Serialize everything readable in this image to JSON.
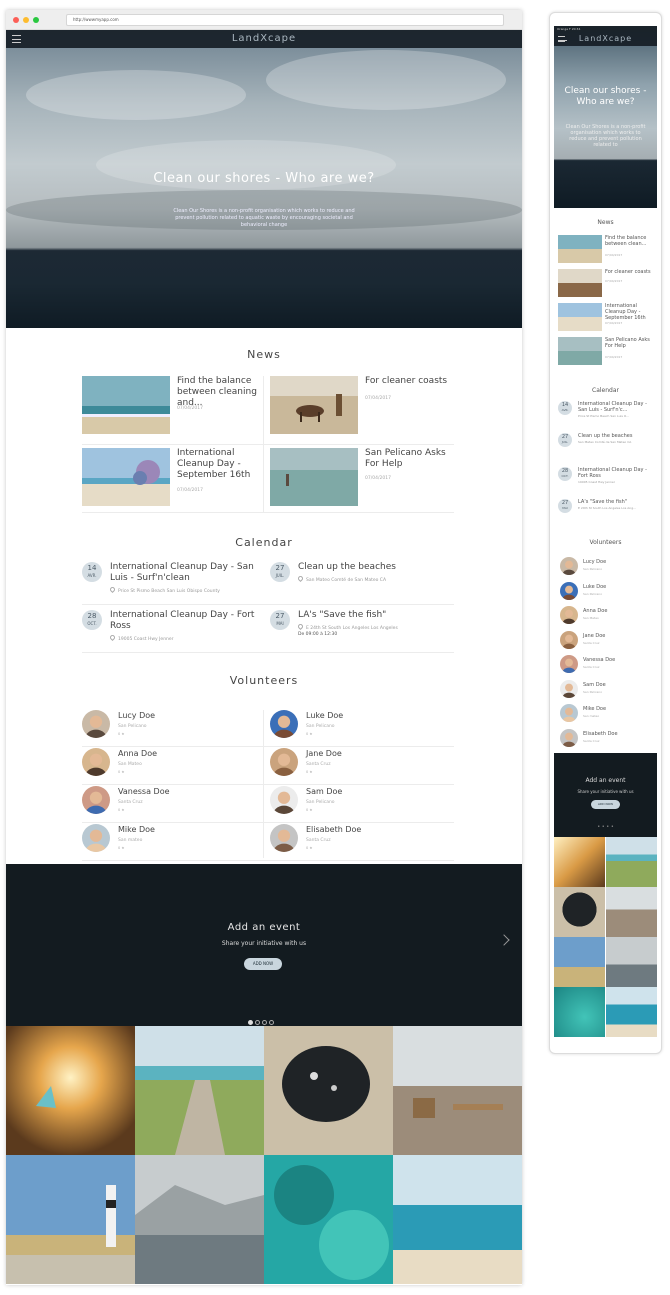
{
  "browser": {
    "url": "http://wwwmyapp.com"
  },
  "brand": "LandXcape",
  "hero": {
    "title": "Clean our shores - Who are we?",
    "desc": "Clean Our Shores is a non-profit organisation which works to reduce and prevent pollution related to aquatic waste by encouraging societal and behavioral change"
  },
  "news": {
    "title": "News",
    "items": [
      {
        "title": "Find the balance between cleaning and...",
        "date": "07/04/2017"
      },
      {
        "title": "For cleaner coasts",
        "date": "07/04/2017"
      },
      {
        "title": "International Cleanup Day - September 16th",
        "date": "07/04/2017"
      },
      {
        "title": "San Pelicano Asks For Help",
        "date": "07/04/2017"
      }
    ]
  },
  "calendar": {
    "title": "Calendar",
    "events": [
      {
        "day": "14",
        "month": "AVR.",
        "title": "International Cleanup Day - San Luis - Surf'n'clean",
        "location": "Price St Pismo Beach San Luis Obispo County",
        "time": ""
      },
      {
        "day": "27",
        "month": "JUIL.",
        "title": "Clean up the beaches",
        "location": "San Mateo Comté de San Mateo CA",
        "time": ""
      },
      {
        "day": "28",
        "month": "OCT.",
        "title": "International Cleanup Day - Fort Ross",
        "location": "19005 Coast Hwy Jenner",
        "time": ""
      },
      {
        "day": "27",
        "month": "MAI",
        "title": "LA's \"Save the fish\"",
        "location": "E 24th St South Los Angeles Los Angeles",
        "time": "De 09:00 à 12:30"
      }
    ]
  },
  "volunteers": {
    "title": "Volunteers",
    "people": [
      {
        "name": "Lucy Doe",
        "city": "San Pelicano",
        "extra": "0 ★"
      },
      {
        "name": "Luke Doe",
        "city": "San Pelicano",
        "extra": "0 ★"
      },
      {
        "name": "Anna Doe",
        "city": "San Mateo",
        "extra": "0 ★"
      },
      {
        "name": "Jane Doe",
        "city": "Santa Cruz",
        "extra": "0 ★"
      },
      {
        "name": "Vanessa Doe",
        "city": "Santa Cruz",
        "extra": "0 ★"
      },
      {
        "name": "Sam Doe",
        "city": "San Pelicano",
        "extra": "0 ★"
      },
      {
        "name": "Mike Doe",
        "city": "San mateo",
        "extra": "0 ★"
      },
      {
        "name": "Elisabeth Doe",
        "city": "Santa Cruz",
        "extra": "0 ★"
      }
    ]
  },
  "event_banner": {
    "title": "Add an event",
    "subtitle": "Share your initiative with us",
    "button": "ADD NOW"
  },
  "mobile": {
    "status": "Orange F   20:34",
    "hero_title": "Clean our shores - Who are we?",
    "hero_desc": "Clean Our Shores is a non-profit organisation which works to reduce and prevent pollution related to",
    "news": [
      {
        "title": "Find the balance between clean...",
        "date": "07/04/2017"
      },
      {
        "title": "For cleaner coasts",
        "date": "07/04/2017"
      },
      {
        "title": "International Cleanup Day - September 16th",
        "date": "07/04/2017"
      },
      {
        "title": "San Pelicano Asks For Help",
        "date": "07/04/2017"
      }
    ],
    "events": [
      {
        "day": "14",
        "month": "AVR.",
        "title": "International Cleanup Day - San Luis - Surf'n'c...",
        "location": "Price St Pismo Beach San Luis O..."
      },
      {
        "day": "27",
        "month": "JUIL.",
        "title": "Clean up the beaches",
        "location": "San Mateo Comté de San Mateo CA"
      },
      {
        "day": "28",
        "month": "OCT.",
        "title": "International Cleanup Day - Fort Ross",
        "location": "19005 Coast Hwy Jenner"
      },
      {
        "day": "27",
        "month": "MAI",
        "title": "LA's \"Save the fish\"",
        "location": "E 24th St South Los Angeles Los Ang..."
      }
    ],
    "dots": "• • • •"
  },
  "colors": {
    "dark": "#131b20",
    "accent": "#c9d6de",
    "badge": "#d4dde3"
  }
}
